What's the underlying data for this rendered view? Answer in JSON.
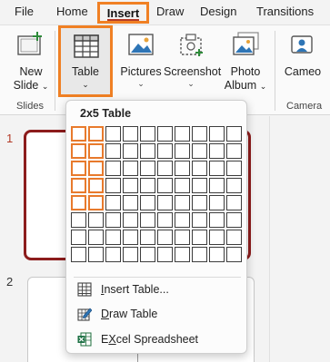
{
  "tabs": {
    "file": "File",
    "home": "Home",
    "insert": "Insert",
    "draw": "Draw",
    "design": "Design",
    "transitions": "Transitions"
  },
  "ribbon": {
    "new_slide": {
      "line1": "New",
      "line2": "Slide"
    },
    "table": "Table",
    "pictures": "Pictures",
    "screenshot": "Screenshot",
    "photo_album": {
      "line1": "Photo",
      "line2": "Album"
    },
    "cameo": "Cameo",
    "groups": {
      "slides": "Slides",
      "camera": "Camera"
    }
  },
  "slides": {
    "first": "1",
    "second": "2"
  },
  "table_menu": {
    "title": "2x5 Table",
    "grid": {
      "columns": 10,
      "rows": 8,
      "selected_columns": 2,
      "selected_rows": 5
    },
    "items": [
      {
        "key": "I",
        "rest": "nsert Table...",
        "icon": "table-grid-icon"
      },
      {
        "key": "D",
        "rest": "raw Table",
        "icon": "pencil-table-icon"
      },
      {
        "key": "X",
        "rest": "cel Spreadsheet",
        "pre": "E",
        "icon": "excel-icon"
      }
    ]
  },
  "colors": {
    "highlight": "#f08024",
    "accent": "#b33b27",
    "slide_border": "#8c1c1c"
  }
}
